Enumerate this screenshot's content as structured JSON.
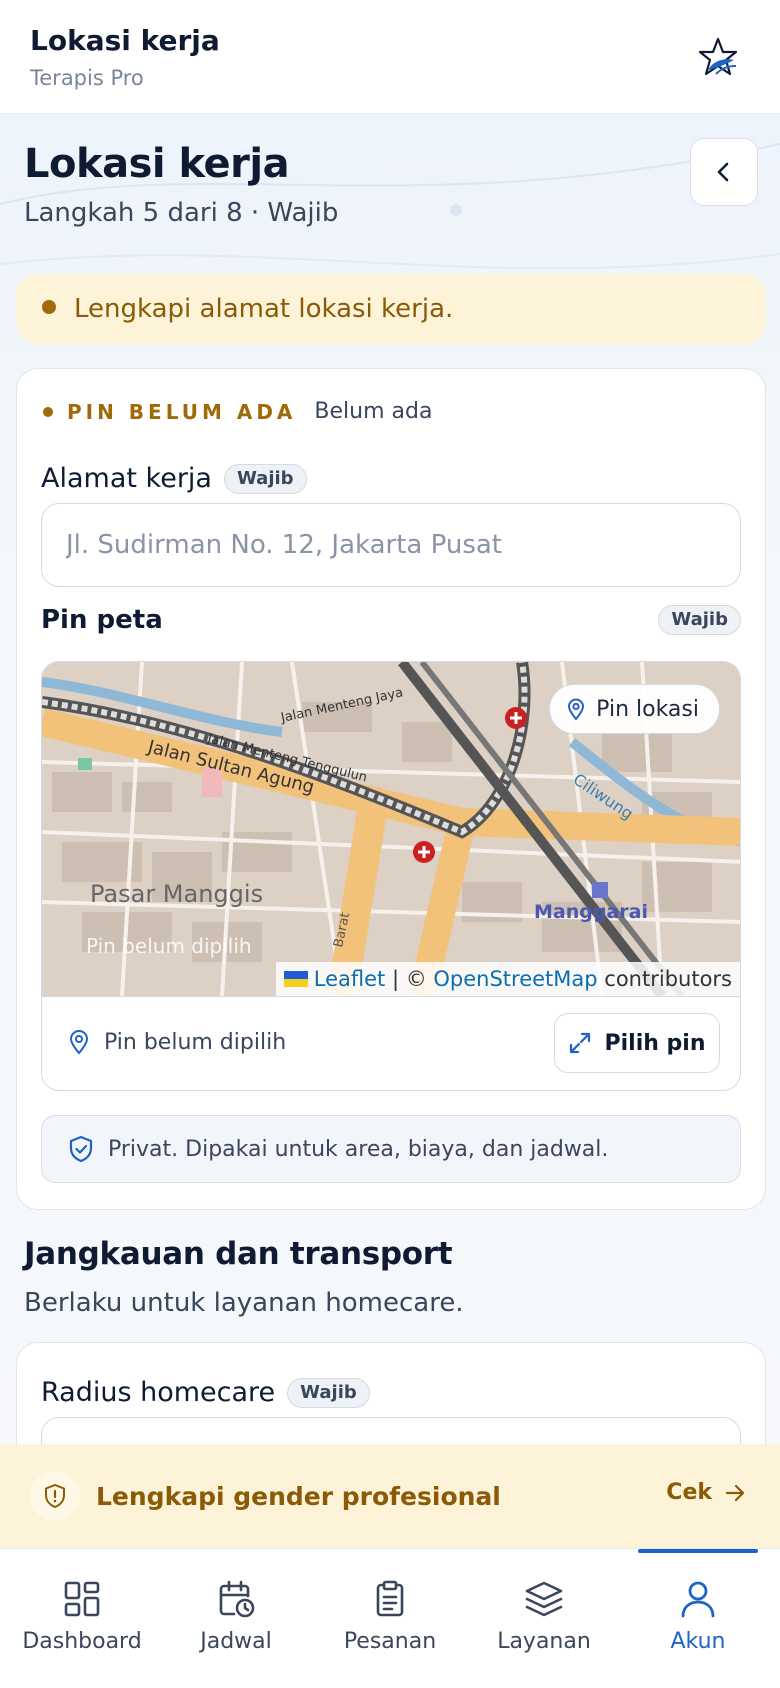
{
  "app_bar": {
    "title": "Lokasi kerja",
    "subtitle": "Terapis Pro",
    "logo_icon": "star-leaf-logo-icon"
  },
  "header": {
    "title": "Lokasi kerja",
    "step": "Langkah 5 dari 8 · Wajib",
    "back_icon": "chevron-left-icon"
  },
  "warning_banner": {
    "text": "Lengkapi alamat lokasi kerja."
  },
  "location_card": {
    "status_label": "PIN BELUM ADA",
    "status_value": "Belum ada",
    "address": {
      "label": "Alamat kerja",
      "badge": "Wajib",
      "value": "",
      "placeholder": "Jl. Sudirman No. 12, Jakarta Pusat"
    },
    "pin": {
      "title": "Pin peta",
      "badge": "Wajib",
      "map_button": "Pin lokasi",
      "overlay_text": "Pin belum dipilih",
      "map_labels": [
        "Jalan Menteng Jaya",
        "Jalan Menteng Tenggulun",
        "Jalan Sultan Agung",
        "Pasar Manggis",
        "Ciliwung",
        "Manggarai",
        "Barat"
      ],
      "attribution": {
        "leaflet": "Leaflet",
        "separator": " | © ",
        "osm": "OpenStreetMap",
        "suffix": " contributors"
      },
      "status_text": "Pin belum dipilih",
      "pick_button": "Pilih pin"
    },
    "privacy_note": "Privat. Dipakai untuk area, biaya, dan jadwal."
  },
  "range_section": {
    "title": "Jangkauan dan transport",
    "subtitle": "Berlaku untuk layanan homecare.",
    "radius": {
      "label": "Radius homecare",
      "badge": "Wajib"
    }
  },
  "bottom_notice": {
    "text": "Lengkapi gender profesional",
    "action": "Cek"
  },
  "bottom_nav": {
    "items": [
      {
        "label": "Dashboard",
        "icon": "dashboard-grid-icon"
      },
      {
        "label": "Jadwal",
        "icon": "calendar-clock-icon"
      },
      {
        "label": "Pesanan",
        "icon": "clipboard-icon"
      },
      {
        "label": "Layanan",
        "icon": "layers-icon"
      },
      {
        "label": "Akun",
        "icon": "user-icon"
      }
    ],
    "active_index": 4
  },
  "colors": {
    "accent": "#1f63c7",
    "warning_bg": "#fdf3d8",
    "warning_text": "#8a5a06",
    "text_primary": "#0f1b33"
  }
}
